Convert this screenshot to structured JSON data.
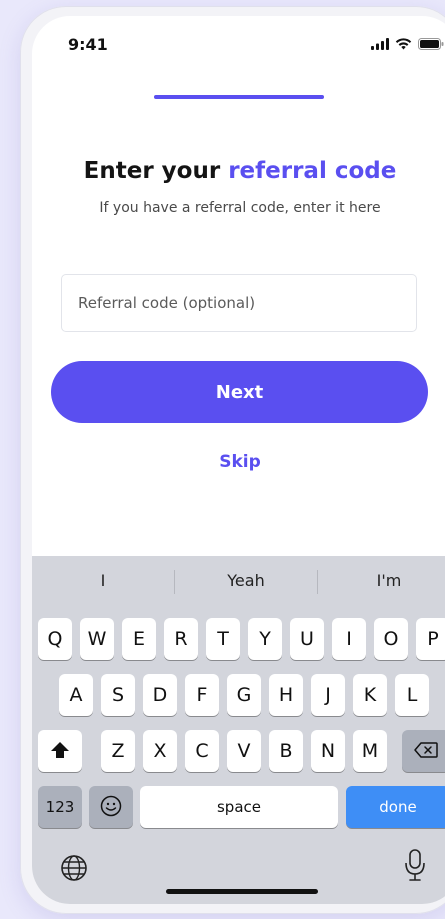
{
  "status_bar": {
    "time": "9:41"
  },
  "progress": {
    "fraction": 1.0
  },
  "heading": {
    "prefix": "Enter your",
    "accent": "referral code",
    "subtitle": "If you have a referral code, enter it here"
  },
  "referral_input": {
    "value": "",
    "placeholder": "Referral code (optional)"
  },
  "buttons": {
    "next": "Next",
    "skip": "Skip"
  },
  "colors": {
    "accent": "#5a4ff0",
    "keyboard_bg": "#d3d5dc",
    "done_key": "#3e8ef6"
  },
  "keyboard": {
    "suggestions": [
      "I",
      "Yeah",
      "I'm"
    ],
    "row1": [
      "Q",
      "W",
      "E",
      "R",
      "T",
      "Y",
      "U",
      "I",
      "O",
      "P"
    ],
    "row2": [
      "A",
      "S",
      "D",
      "F",
      "G",
      "H",
      "J",
      "K",
      "L"
    ],
    "row3": [
      "Z",
      "X",
      "C",
      "V",
      "B",
      "N",
      "M"
    ],
    "numbers_key": "123",
    "space_key": "space",
    "done_key": "done",
    "icons": {
      "shift": "shift-icon",
      "backspace": "backspace-icon",
      "emoji": "emoji-icon",
      "globe": "globe-icon",
      "mic": "microphone-icon"
    }
  }
}
